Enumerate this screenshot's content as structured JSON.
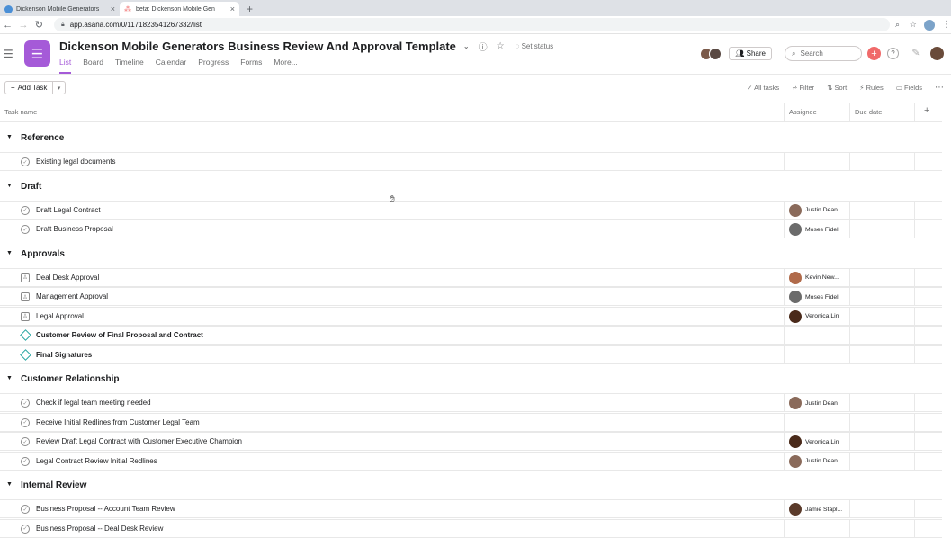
{
  "browser": {
    "tabs": [
      {
        "title": "Dickenson Mobile Generators",
        "active": false
      },
      {
        "title": "beta: Dickenson Mobile Gen",
        "active": true
      }
    ],
    "url": "app.asana.com/0/1171823541267332/list"
  },
  "project": {
    "title": "Dickenson Mobile Generators Business Review And Approval Template",
    "set_status": "Set status",
    "accent_color": "#a55ad8",
    "tabs": [
      "List",
      "Board",
      "Timeline",
      "Calendar",
      "Progress",
      "Forms",
      "More..."
    ],
    "active_tab": "List",
    "share_label": "Share",
    "search_placeholder": "Search"
  },
  "toolbar": {
    "add_task": "Add Task",
    "all_tasks": "All tasks",
    "filter": "Filter",
    "sort": "Sort",
    "rules": "Rules",
    "fields": "Fields"
  },
  "columns": {
    "task_name": "Task name",
    "assignee": "Assignee",
    "due_date": "Due date"
  },
  "sections": [
    {
      "name": "Reference",
      "tasks": [
        {
          "name": "Existing legal documents",
          "type": "task",
          "assignee": ""
        }
      ]
    },
    {
      "name": "Draft",
      "tasks": [
        {
          "name": "Draft Legal Contract",
          "type": "task",
          "assignee": "Justin Dean"
        },
        {
          "name": "Draft Business Proposal",
          "type": "task",
          "assignee": "Moses Fidel"
        }
      ]
    },
    {
      "name": "Approvals",
      "tasks": [
        {
          "name": "Deal Desk Approval",
          "type": "approval",
          "assignee": "Kevin New..."
        },
        {
          "name": "Management Approval",
          "type": "approval",
          "assignee": "Moses Fidel"
        },
        {
          "name": "Legal Approval",
          "type": "approval",
          "assignee": "Veronica Lin"
        },
        {
          "name": "Customer Review of Final Proposal and Contract",
          "type": "milestone",
          "assignee": ""
        },
        {
          "name": "Final Signatures",
          "type": "milestone",
          "assignee": ""
        }
      ]
    },
    {
      "name": "Customer Relationship",
      "tasks": [
        {
          "name": "Check if legal team meeting needed",
          "type": "task",
          "assignee": "Justin Dean"
        },
        {
          "name": "Receive Initial Redlines from Customer Legal Team",
          "type": "task",
          "assignee": ""
        },
        {
          "name": "Review Draft Legal Contract with Customer Executive Champion",
          "type": "task",
          "assignee": "Veronica Lin"
        },
        {
          "name": "Legal Contract Review Initial Redlines",
          "type": "task",
          "assignee": "Justin Dean"
        }
      ]
    },
    {
      "name": "Internal Review",
      "tasks": [
        {
          "name": "Business Proposal -- Account Team Review",
          "type": "task",
          "assignee": "Jamie Stapl..."
        },
        {
          "name": "Business Proposal -- Deal Desk Review",
          "type": "task",
          "assignee": ""
        }
      ]
    }
  ]
}
